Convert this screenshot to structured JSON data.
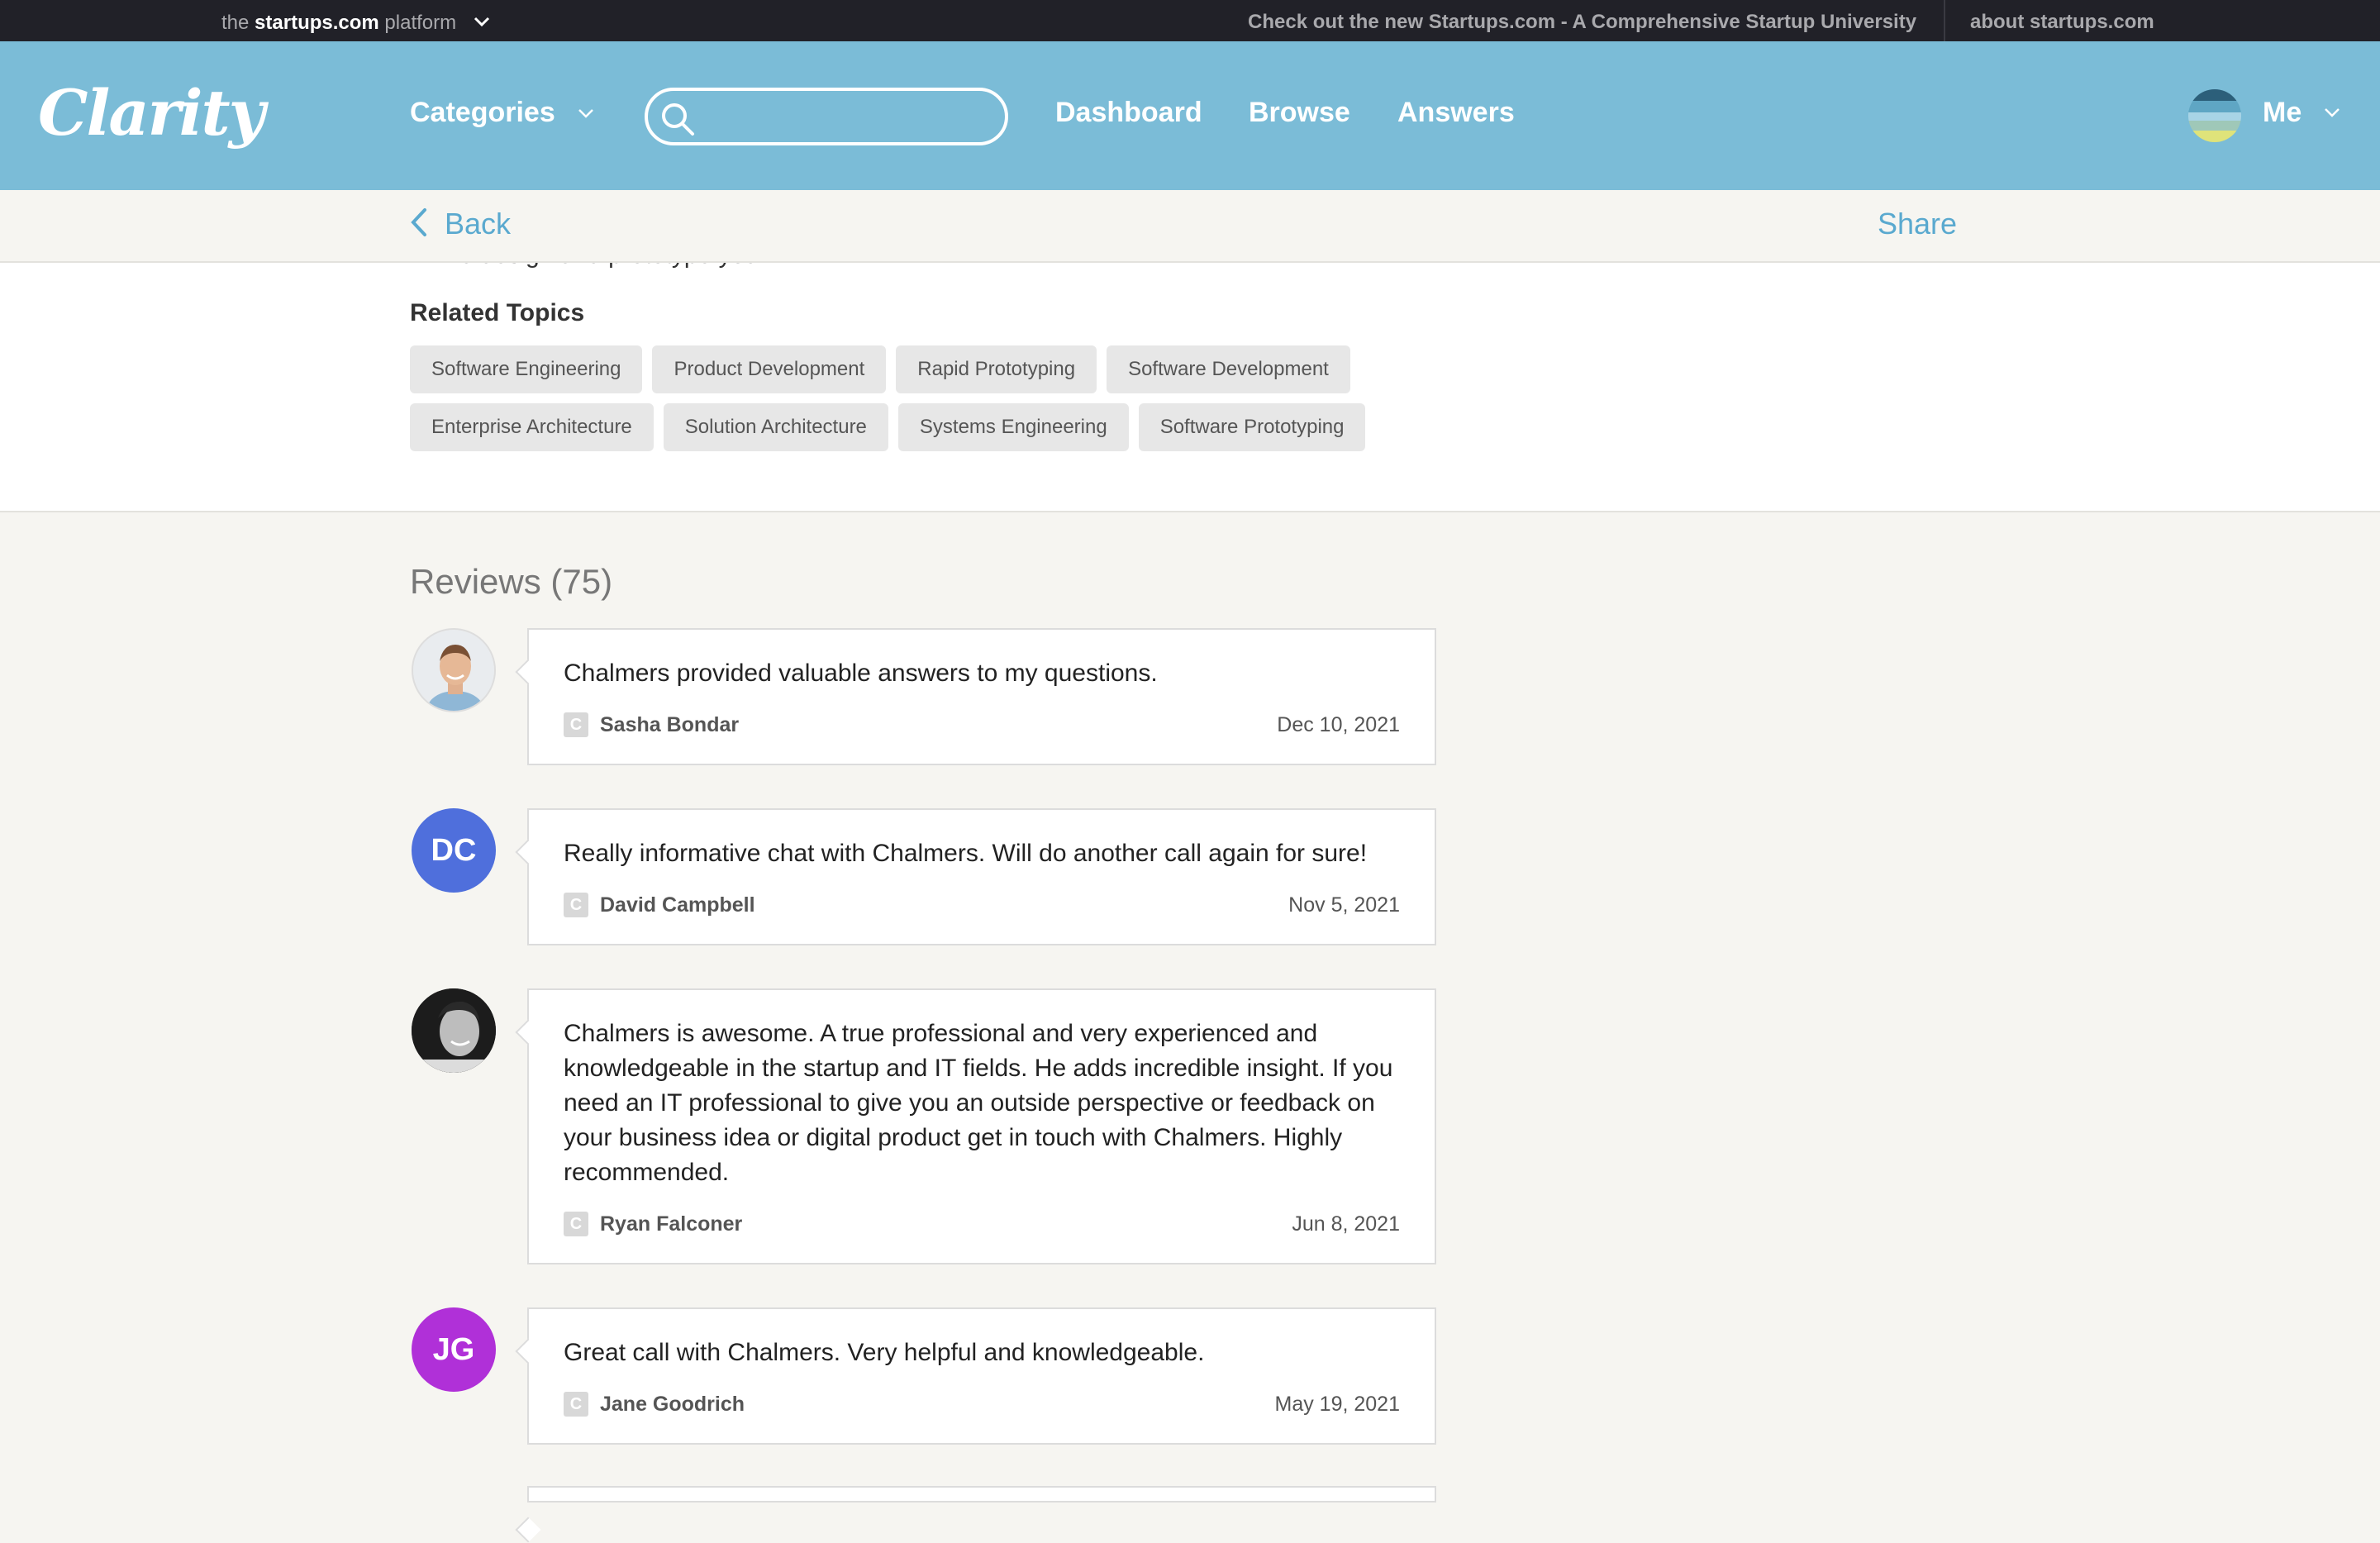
{
  "topbar": {
    "platform_prefix": "the",
    "platform_brand": "startups.com",
    "platform_suffix": "platform",
    "promo_link": "Check out the new Startups.com - A Comprehensive Startup University",
    "about_link": "about startups.com"
  },
  "header": {
    "logo": "Clarity",
    "categories_label": "Categories",
    "search": {
      "value": "",
      "placeholder": ""
    },
    "nav": [
      "Dashboard",
      "Browse",
      "Answers"
    ],
    "me_label": "Me",
    "accent_color": "#7bbcd7"
  },
  "backbar": {
    "back_label": "Back",
    "share_label": "Share"
  },
  "related": {
    "cutoff_text": "… we design and prototype your …",
    "title": "Related Topics",
    "tags": [
      "Software Engineering",
      "Product Development",
      "Rapid Prototyping",
      "Software Development",
      "Enterprise Architecture",
      "Solution Architecture",
      "Systems Engineering",
      "Software Prototyping"
    ]
  },
  "reviews": {
    "title": "Reviews (75)",
    "items": [
      {
        "text": "Chalmers provided valuable answers to my questions.",
        "author": "Sasha Bondar",
        "date": "Dec 10, 2021",
        "avatar_type": "photo",
        "initials": ""
      },
      {
        "text": "Really informative chat with Chalmers. Will do another call again for sure!",
        "author": "David Campbell",
        "date": "Nov 5, 2021",
        "avatar_type": "initials",
        "initials": "DC",
        "avatar_color": "#4f6fdc"
      },
      {
        "text": "Chalmers is awesome. A true professional and very experienced and knowledgeable in the startup and IT fields. He adds incredible insight. If you need an IT professional to give you an outside perspective or feedback on your business idea or digital product get in touch with Chalmers. Highly recommended.",
        "author": "Ryan Falconer",
        "date": "Jun 8, 2021",
        "avatar_type": "photo",
        "initials": ""
      },
      {
        "text": "Great call with Chalmers. Very helpful and knowledgeable.",
        "author": "Jane Goodrich",
        "date": "May 19, 2021",
        "avatar_type": "initials",
        "initials": "JG",
        "avatar_color": "#b030d8"
      }
    ],
    "source_icon_letter": "C"
  }
}
